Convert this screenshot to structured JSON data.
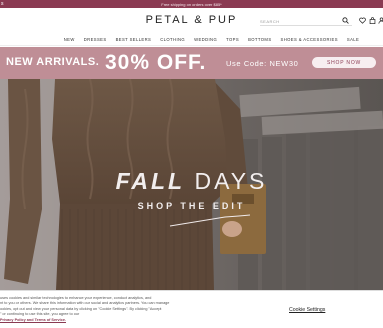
{
  "announcement": {
    "left_glyph": "s",
    "text": "Free shipping on orders over $85*"
  },
  "header": {
    "logo": "PETAL & PUP",
    "search_placeholder": "SEARCH",
    "icons": [
      "search-icon",
      "heart-icon",
      "bag-icon",
      "account-icon"
    ]
  },
  "nav": {
    "items": [
      "NEW",
      "DRESSES",
      "BEST SELLERS",
      "CLOTHING",
      "WEDDING",
      "TOPS",
      "BOTTOMS",
      "SHOES & ACCESSORIES",
      "SALE"
    ]
  },
  "promo": {
    "new_arrivals": "NEW ARRIVALS.",
    "discount": "30% OFF.",
    "code": "Use Code: NEW30",
    "button": "SHOP NOW",
    "bg_color": "#bf8e96"
  },
  "hero": {
    "title_part1": "FALL",
    "title_part2": "DAYS",
    "cta": "SHOP THE EDIT"
  },
  "cookie": {
    "line1": "uses cookies and similar technologies to enhance your experience, conduct analytics, and",
    "line2": "nt to you or others. We share this information with our social and analytics partners. You can manage",
    "line3": "ookies, opt out and view your personal data by clicking on \"Cookie Settings\". By clicking \"Accept",
    "line4": "\" or continuing to use this site, you agree to our",
    "policy_link": "Privacy Policy and Terms of Service.",
    "settings_label": "Cookie Settings"
  }
}
